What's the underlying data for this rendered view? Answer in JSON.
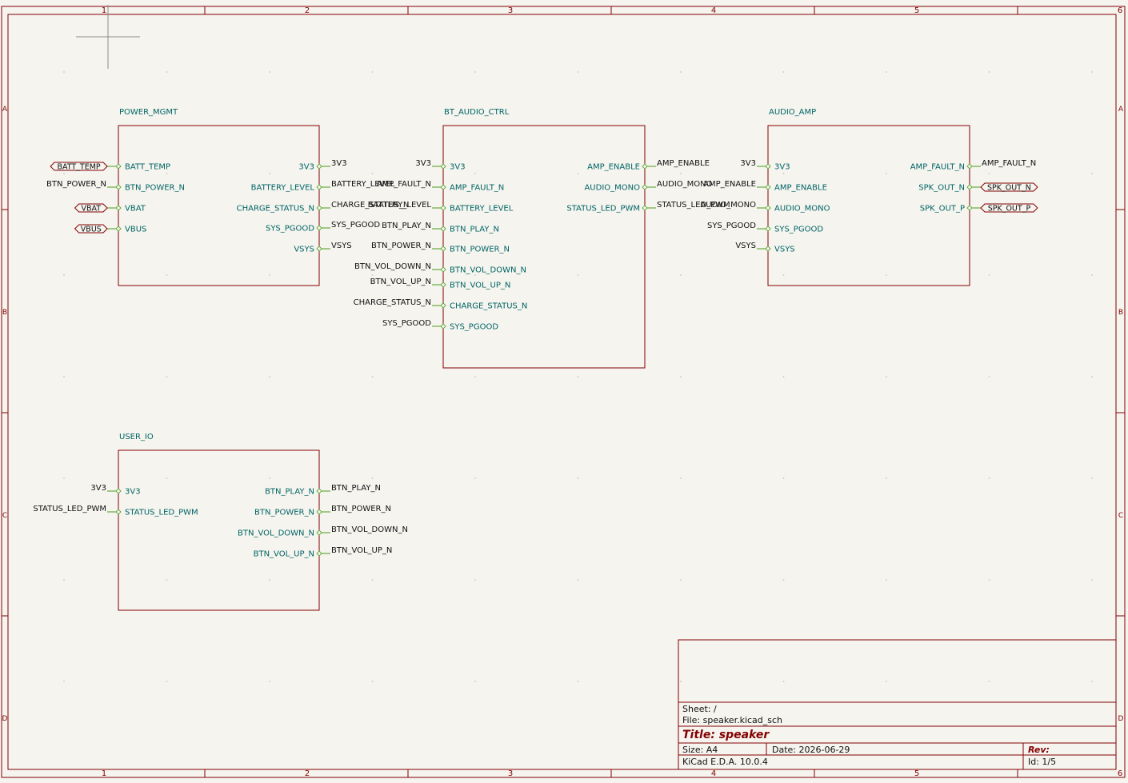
{
  "colors": {
    "background": "#f5f4ef",
    "border": "#840000",
    "wire": "#4c9a1a",
    "pin_text": "#006464",
    "label_text": "#111111",
    "sheet_name": "#006464",
    "grid": "#c8c6be"
  },
  "frame": {
    "columns": [
      "1",
      "2",
      "3",
      "4",
      "5",
      "6"
    ],
    "rows": [
      "A",
      "B",
      "C",
      "D"
    ]
  },
  "sheets": [
    {
      "id": "power_mgmt",
      "name": "POWER_MGMT",
      "pins": [
        {
          "label": "BATT_TEMP",
          "side": "left",
          "net": "BATT_TEMP",
          "net_style": "global"
        },
        {
          "label": "BTN_POWER_N",
          "side": "left",
          "net": "BTN_POWER_N",
          "net_style": "local"
        },
        {
          "label": "VBAT",
          "side": "left",
          "net": "VBAT",
          "net_style": "global"
        },
        {
          "label": "VBUS",
          "side": "left",
          "net": "VBUS",
          "net_style": "global"
        },
        {
          "label": "3V3",
          "side": "right",
          "net": "3V3",
          "net_style": "local"
        },
        {
          "label": "BATTERY_LEVEL",
          "side": "right",
          "net": "BATTERY_LEVEL",
          "net_style": "local"
        },
        {
          "label": "CHARGE_STATUS_N",
          "side": "right",
          "net": "CHARGE_STATUS_N",
          "net_style": "local"
        },
        {
          "label": "SYS_PGOOD",
          "side": "right",
          "net": "SYS_PGOOD",
          "net_style": "local"
        },
        {
          "label": "VSYS",
          "side": "right",
          "net": "VSYS",
          "net_style": "local"
        }
      ]
    },
    {
      "id": "bt_audio_ctrl",
      "name": "BT_AUDIO_CTRL",
      "pins": [
        {
          "label": "3V3",
          "side": "left",
          "net": "3V3",
          "net_style": "local"
        },
        {
          "label": "AMP_FAULT_N",
          "side": "left",
          "net": "AMP_FAULT_N",
          "net_style": "local"
        },
        {
          "label": "BATTERY_LEVEL",
          "side": "left",
          "net": "BATTERY_LEVEL",
          "net_style": "local"
        },
        {
          "label": "BTN_PLAY_N",
          "side": "left",
          "net": "BTN_PLAY_N",
          "net_style": "local"
        },
        {
          "label": "BTN_POWER_N",
          "side": "left",
          "net": "BTN_POWER_N",
          "net_style": "local"
        },
        {
          "label": "BTN_VOL_DOWN_N",
          "side": "left",
          "net": "BTN_VOL_DOWN_N",
          "net_style": "local"
        },
        {
          "label": "BTN_VOL_UP_N",
          "side": "left",
          "net": "BTN_VOL_UP_N",
          "net_style": "local"
        },
        {
          "label": "CHARGE_STATUS_N",
          "side": "left",
          "net": "CHARGE_STATUS_N",
          "net_style": "local"
        },
        {
          "label": "SYS_PGOOD",
          "side": "left",
          "net": "SYS_PGOOD",
          "net_style": "local"
        },
        {
          "label": "AMP_ENABLE",
          "side": "right",
          "net": "AMP_ENABLE",
          "net_style": "local"
        },
        {
          "label": "AUDIO_MONO",
          "side": "right",
          "net": "AUDIO_MONO",
          "net_style": "local"
        },
        {
          "label": "STATUS_LED_PWM",
          "side": "right",
          "net": "STATUS_LED_PWM",
          "net_style": "local"
        }
      ]
    },
    {
      "id": "audio_amp",
      "name": "AUDIO_AMP",
      "pins": [
        {
          "label": "3V3",
          "side": "left",
          "net": "3V3",
          "net_style": "local"
        },
        {
          "label": "AMP_ENABLE",
          "side": "left",
          "net": "AMP_ENABLE",
          "net_style": "local"
        },
        {
          "label": "AUDIO_MONO",
          "side": "left",
          "net": "AUDIO_MONO",
          "net_style": "local"
        },
        {
          "label": "SYS_PGOOD",
          "side": "left",
          "net": "SYS_PGOOD",
          "net_style": "local"
        },
        {
          "label": "VSYS",
          "side": "left",
          "net": "VSYS",
          "net_style": "local"
        },
        {
          "label": "AMP_FAULT_N",
          "side": "right",
          "net": "AMP_FAULT_N",
          "net_style": "local"
        },
        {
          "label": "SPK_OUT_N",
          "side": "right",
          "net": "SPK_OUT_N",
          "net_style": "global"
        },
        {
          "label": "SPK_OUT_P",
          "side": "right",
          "net": "SPK_OUT_P",
          "net_style": "global"
        }
      ]
    },
    {
      "id": "user_io",
      "name": "USER_IO",
      "pins": [
        {
          "label": "3V3",
          "side": "left",
          "net": "3V3",
          "net_style": "local"
        },
        {
          "label": "STATUS_LED_PWM",
          "side": "left",
          "net": "STATUS_LED_PWM",
          "net_style": "local"
        },
        {
          "label": "BTN_PLAY_N",
          "side": "right",
          "net": "BTN_PLAY_N",
          "net_style": "local"
        },
        {
          "label": "BTN_POWER_N",
          "side": "right",
          "net": "BTN_POWER_N",
          "net_style": "local"
        },
        {
          "label": "BTN_VOL_DOWN_N",
          "side": "right",
          "net": "BTN_VOL_DOWN_N",
          "net_style": "local"
        },
        {
          "label": "BTN_VOL_UP_N",
          "side": "right",
          "net": "BTN_VOL_UP_N",
          "net_style": "local"
        }
      ]
    }
  ],
  "title_block": {
    "sheet": "Sheet: /",
    "file": "File: speaker.kicad_sch",
    "title": "Title: speaker",
    "size": "Size: A4",
    "date": "Date: 2026-06-29",
    "rev": "Rev:",
    "tool": "KiCad E.D.A. 10.0.4",
    "id": "Id: 1/5"
  }
}
